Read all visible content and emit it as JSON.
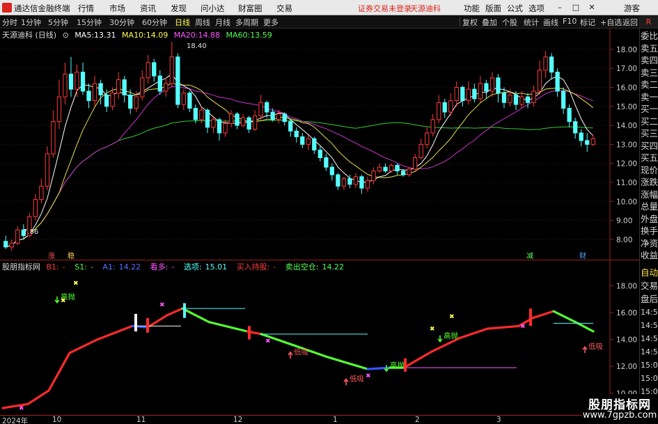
{
  "menubar": {
    "app_title": "通达信金融终端",
    "menus": [
      "行情",
      "市场",
      "资讯",
      "发现",
      "问小达",
      "财富圈",
      "交易"
    ],
    "notice": "证券交易未登录",
    "stock_name": "天源迪科",
    "right_menus": [
      "功能",
      "版面",
      "公式",
      "选项"
    ],
    "guest": "游客",
    "window_controls": [
      "minimize-icon",
      "maximize-icon",
      "close-icon"
    ]
  },
  "toolbar": {
    "periods": [
      "分时",
      "1分钟",
      "5分钟",
      "15分钟",
      "30分钟",
      "60分钟",
      "日线",
      "周线",
      "月线",
      "多周期",
      "更多"
    ],
    "active_period": "日线",
    "tools": [
      "复权",
      "叠加",
      "个股",
      "统计",
      "画线",
      "F10",
      "标记",
      "+自选",
      "返回"
    ],
    "right_badge": "R"
  },
  "main_chart": {
    "stock_label": "天源迪科 (日线)",
    "ma": [
      {
        "name": "MA5:",
        "value": "13.31",
        "color": "#ffffff"
      },
      {
        "name": "MA10:",
        "value": "14.09",
        "color": "#ffff55"
      },
      {
        "name": "MA20:",
        "value": "14.88",
        "color": "#ff55ff"
      },
      {
        "name": "MA60:",
        "value": "13.59",
        "color": "#55ff55"
      }
    ],
    "high_label": "18.40",
    "low_label": "7.86",
    "y_ticks": [
      "18.00",
      "17.00",
      "16.00",
      "15.00",
      "14.00",
      "13.00",
      "12.00",
      "11.00",
      "10.00",
      "9.00",
      "8.00"
    ],
    "markers": [
      "涨",
      "稳",
      "减",
      "财"
    ]
  },
  "chart_data": {
    "type": "candlestick",
    "ylim": [
      7.3,
      18.8
    ],
    "candles": [
      [
        7.9,
        7.6,
        8.2,
        7.5
      ],
      [
        7.6,
        7.8,
        8.0,
        7.4
      ],
      [
        7.8,
        8.5,
        8.7,
        7.7
      ],
      [
        8.5,
        8.2,
        8.8,
        8.0
      ],
      [
        8.2,
        9.2,
        9.4,
        8.1
      ],
      [
        9.2,
        10.1,
        10.4,
        9.0
      ],
      [
        10.1,
        10.8,
        11.2,
        9.9
      ],
      [
        10.8,
        12.5,
        12.9,
        10.6
      ],
      [
        12.5,
        14.2,
        14.8,
        12.3
      ],
      [
        14.2,
        15.5,
        16.4,
        13.8
      ],
      [
        15.5,
        16.7,
        17.3,
        15.1
      ],
      [
        16.7,
        15.9,
        17.6,
        15.5
      ],
      [
        15.9,
        16.8,
        17.2,
        15.5
      ],
      [
        16.8,
        15.8,
        17.3,
        15.6
      ],
      [
        15.8,
        15.3,
        16.2,
        14.9
      ],
      [
        15.3,
        16.2,
        16.6,
        15.0
      ],
      [
        16.2,
        15.6,
        16.4,
        15.1
      ],
      [
        15.6,
        15.0,
        15.9,
        14.7
      ],
      [
        15.0,
        15.7,
        16.0,
        14.8
      ],
      [
        15.7,
        16.4,
        16.8,
        15.4
      ],
      [
        16.4,
        15.6,
        16.6,
        15.2
      ],
      [
        15.6,
        14.9,
        15.9,
        14.6
      ],
      [
        14.9,
        15.5,
        15.8,
        14.7
      ],
      [
        15.5,
        16.5,
        16.9,
        15.3
      ],
      [
        16.5,
        17.3,
        17.7,
        16.2
      ],
      [
        17.3,
        16.6,
        17.5,
        16.3
      ],
      [
        16.6,
        15.8,
        16.9,
        15.6
      ],
      [
        15.8,
        16.2,
        16.5,
        15.5
      ],
      [
        16.2,
        17.6,
        18.4,
        16.0
      ],
      [
        17.6,
        15.1,
        17.8,
        14.9
      ],
      [
        15.1,
        15.7,
        15.9,
        14.8
      ],
      [
        15.7,
        14.9,
        15.8,
        14.7
      ],
      [
        14.9,
        14.3,
        15.1,
        14.1
      ],
      [
        14.3,
        14.8,
        15.0,
        14.1
      ],
      [
        14.8,
        13.9,
        14.9,
        13.6
      ],
      [
        13.9,
        14.3,
        14.5,
        13.6
      ],
      [
        14.3,
        13.6,
        14.4,
        13.2
      ],
      [
        13.6,
        14.1,
        14.3,
        13.4
      ],
      [
        14.1,
        14.6,
        14.8,
        13.9
      ],
      [
        14.6,
        14.0,
        14.7,
        13.8
      ],
      [
        14.0,
        14.4,
        14.6,
        13.9
      ],
      [
        14.4,
        13.8,
        14.5,
        13.6
      ],
      [
        13.8,
        14.5,
        14.8,
        13.7
      ],
      [
        14.5,
        15.2,
        15.6,
        14.3
      ],
      [
        15.2,
        14.7,
        15.3,
        14.4
      ],
      [
        14.7,
        14.3,
        14.9,
        14.2
      ],
      [
        14.3,
        14.6,
        14.8,
        14.1
      ],
      [
        14.6,
        14.2,
        14.7,
        14.0
      ],
      [
        14.2,
        13.7,
        14.3,
        13.4
      ],
      [
        13.7,
        13.4,
        13.9,
        13.1
      ],
      [
        13.4,
        13.0,
        13.6,
        12.8
      ],
      [
        13.0,
        13.3,
        13.5,
        12.7
      ],
      [
        13.3,
        12.7,
        13.4,
        12.5
      ],
      [
        12.7,
        12.3,
        12.9,
        12.1
      ],
      [
        12.3,
        11.8,
        12.5,
        11.6
      ],
      [
        11.8,
        11.4,
        12.0,
        11.1
      ],
      [
        11.4,
        10.8,
        11.5,
        10.6
      ],
      [
        10.8,
        11.2,
        11.3,
        10.6
      ],
      [
        11.2,
        10.9,
        11.4,
        10.7
      ],
      [
        10.9,
        11.3,
        11.5,
        10.7
      ],
      [
        11.3,
        10.7,
        11.4,
        10.4
      ],
      [
        10.7,
        11.1,
        11.3,
        10.5
      ],
      [
        11.1,
        11.6,
        11.8,
        10.9
      ],
      [
        11.6,
        11.8,
        12.0,
        11.5
      ],
      [
        11.8,
        11.6,
        12.0,
        11.5
      ],
      [
        11.6,
        11.9,
        12.0,
        11.5
      ],
      [
        11.9,
        11.6,
        12.0,
        11.4
      ],
      [
        11.6,
        11.4,
        11.7,
        11.3
      ],
      [
        11.4,
        11.7,
        11.8,
        11.3
      ],
      [
        11.7,
        12.3,
        12.5,
        11.6
      ],
      [
        12.3,
        13.0,
        13.3,
        12.2
      ],
      [
        13.0,
        13.6,
        13.9,
        12.8
      ],
      [
        13.6,
        14.3,
        14.6,
        13.4
      ],
      [
        14.3,
        15.2,
        15.6,
        14.1
      ],
      [
        15.2,
        14.7,
        15.4,
        14.4
      ],
      [
        14.7,
        15.3,
        15.7,
        14.5
      ],
      [
        15.3,
        16.0,
        16.3,
        15.0
      ],
      [
        16.0,
        15.3,
        16.1,
        15.0
      ],
      [
        15.3,
        15.9,
        16.3,
        15.1
      ],
      [
        15.9,
        15.4,
        16.2,
        15.2
      ],
      [
        15.4,
        16.2,
        16.6,
        15.2
      ],
      [
        16.2,
        15.8,
        16.4,
        15.4
      ],
      [
        15.8,
        16.5,
        16.8,
        15.5
      ],
      [
        16.5,
        15.7,
        16.7,
        15.2
      ],
      [
        15.7,
        15.2,
        16.0,
        14.9
      ],
      [
        15.2,
        15.6,
        15.9,
        15.0
      ],
      [
        15.6,
        15.1,
        15.8,
        14.8
      ],
      [
        15.1,
        15.5,
        15.8,
        14.9
      ],
      [
        15.5,
        15.2,
        15.7,
        14.9
      ],
      [
        15.2,
        15.8,
        16.1,
        15.0
      ],
      [
        15.8,
        16.9,
        17.4,
        15.6
      ],
      [
        16.9,
        17.6,
        17.9,
        16.5
      ],
      [
        17.6,
        16.8,
        17.8,
        16.4
      ],
      [
        16.8,
        15.8,
        17.0,
        15.5
      ],
      [
        15.8,
        14.9,
        16.0,
        14.6
      ],
      [
        14.9,
        14.2,
        15.1,
        13.9
      ],
      [
        14.2,
        13.6,
        14.4,
        13.3
      ],
      [
        13.6,
        13.2,
        13.8,
        12.9
      ],
      [
        13.2,
        13.0,
        13.6,
        12.6
      ],
      [
        13.0,
        13.3,
        13.5,
        12.9
      ]
    ]
  },
  "indicator": {
    "name": "股朋指标网",
    "items": [
      {
        "label": "B1:",
        "value": "-",
        "color": "#ff3b3b"
      },
      {
        "label": "S1:",
        "value": "-",
        "color": "#55ff55"
      },
      {
        "label": "A1:",
        "value": "14.22",
        "color": "#5570ff"
      },
      {
        "label": "看多:",
        "value": "-",
        "color": "#ff55ff"
      },
      {
        "label": "选项:",
        "value": "15.01",
        "color": "#55ffff"
      },
      {
        "label": "买入持股:",
        "value": "-",
        "color": "#ff3b3b"
      },
      {
        "label": "卖出空仓:",
        "value": "14.22",
        "color": "#55ff55"
      }
    ],
    "y_ticks": [
      "18.00",
      "16.00",
      "14.00",
      "12.00",
      "10.00"
    ],
    "annotations": [
      "高抛",
      "低吸",
      "低吸",
      "高抛",
      "高抛",
      "低吸"
    ]
  },
  "right_column": {
    "top_items": [
      "委比",
      "卖五",
      "卖四",
      "卖三",
      "卖二",
      "卖一",
      "买一",
      "买二",
      "买三",
      "买四",
      "买五",
      "现价",
      "涨跌",
      "涨幅",
      "总量",
      "外盘",
      "换手",
      "净资",
      "收益"
    ],
    "bottom_items": [
      "自动",
      "交易",
      "盘后",
      "14:5",
      "14:5",
      "14:5",
      "14:5",
      "15:0",
      "15:0",
      "15:0"
    ]
  },
  "date_axis": {
    "labels": [
      "2024年",
      "10",
      "11",
      "12",
      "1",
      "2",
      "3"
    ]
  },
  "watermark": {
    "title": "股朋指标网",
    "url": "www.7gpzb.com"
  }
}
